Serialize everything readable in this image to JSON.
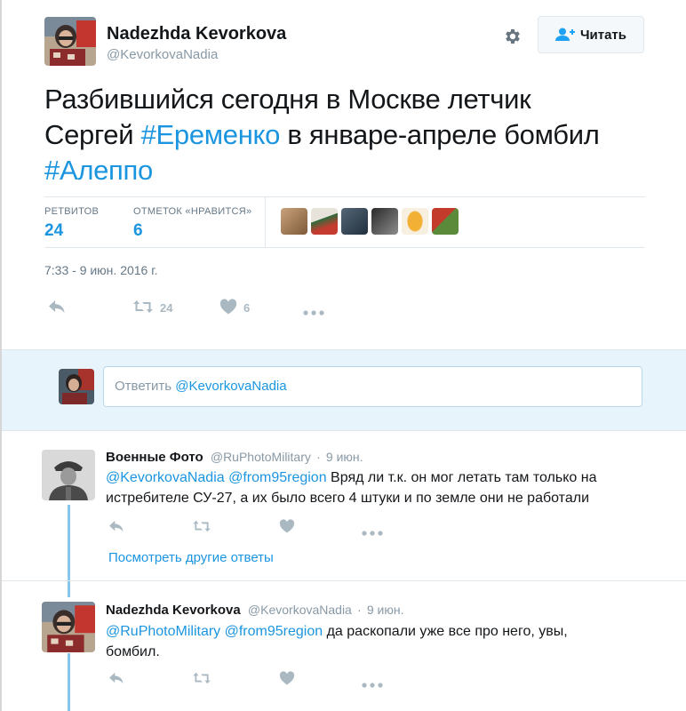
{
  "author": {
    "name": "Nadezhda Kevorkova",
    "handle": "@KevorkovaNadia"
  },
  "follow_button": {
    "label": "Читать"
  },
  "tweet": {
    "line1": "Разбившийся сегодня в Москве летчик",
    "line2_prefix": "Сергей ",
    "hashtag1": "#Еременко",
    "line2_suffix": " в январе-апреле бомбил",
    "hashtag2": "#Алеппо"
  },
  "stats": {
    "retweets_label": "РЕТВИТОВ",
    "retweets_value": "24",
    "likes_label": "ОТМЕТОК «НРАВИТСЯ»",
    "likes_value": "6"
  },
  "timestamp": "7:33 - 9 июн. 2016 г.",
  "actions": {
    "retweet_count": "24",
    "like_count": "6"
  },
  "reply_box": {
    "prefix": "Ответить ",
    "mention": "@KevorkovaNadia"
  },
  "replies": [
    {
      "name": "Военные Фото",
      "handle": "@RuPhotoMilitary",
      "time": "9 июн.",
      "mentions": "@KevorkovaNadia @from95region",
      "text": " Вряд ли т.к. он мог летать там только на истребителе СУ-27, а их было всего 4 штуки и по земле они не работали"
    },
    {
      "name": "Nadezhda Kevorkova",
      "handle": "@KevorkovaNadia",
      "time": "9 июн.",
      "mentions": "@RuPhotoMilitary @from95region",
      "text": " да раскопали уже все про него, увы, бомбил."
    }
  ],
  "more_replies_link": "Посмотреть другие ответы",
  "colors": {
    "link": "#1b95e0",
    "thread_line": "#89c6ec",
    "reply_area_bg": "#e8f4fb"
  }
}
